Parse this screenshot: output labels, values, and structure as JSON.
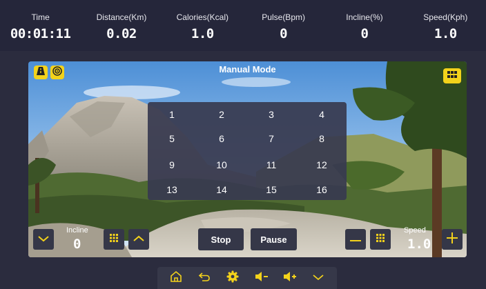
{
  "stats": [
    {
      "label": "Time",
      "value": "00:01:11"
    },
    {
      "label": "Distance(Km)",
      "value": "0.02"
    },
    {
      "label": "Calories(Kcal)",
      "value": "1.0"
    },
    {
      "label": "Pulse(Bpm)",
      "value": "0"
    },
    {
      "label": "Incline(%)",
      "value": "0"
    },
    {
      "label": "Speed(Kph)",
      "value": "1.0"
    }
  ],
  "mode": {
    "title": "Manual Mode"
  },
  "program_grid": {
    "numbers": [
      "1",
      "2",
      "3",
      "4",
      "5",
      "6",
      "7",
      "8",
      "9",
      "10",
      "11",
      "12",
      "13",
      "14",
      "15",
      "16"
    ]
  },
  "incline_control": {
    "label": "Incline",
    "value": "0"
  },
  "speed_control": {
    "label": "Speed",
    "value": "1.0"
  },
  "actions": {
    "stop_label": "Stop",
    "pause_label": "Pause"
  },
  "colors": {
    "background": "#2b2c3e",
    "stats_bar": "#25263a",
    "accent": "#f3d21b",
    "button": "#353748",
    "popup": "#383a50"
  },
  "icons": {
    "badge_left": "road-icon",
    "badge_right": "target-icon",
    "grid_toggle": "grid-icon",
    "nav": [
      "home-icon",
      "back-icon",
      "settings-icon",
      "volume-down-icon",
      "volume-up-icon",
      "chevron-down-icon"
    ]
  }
}
